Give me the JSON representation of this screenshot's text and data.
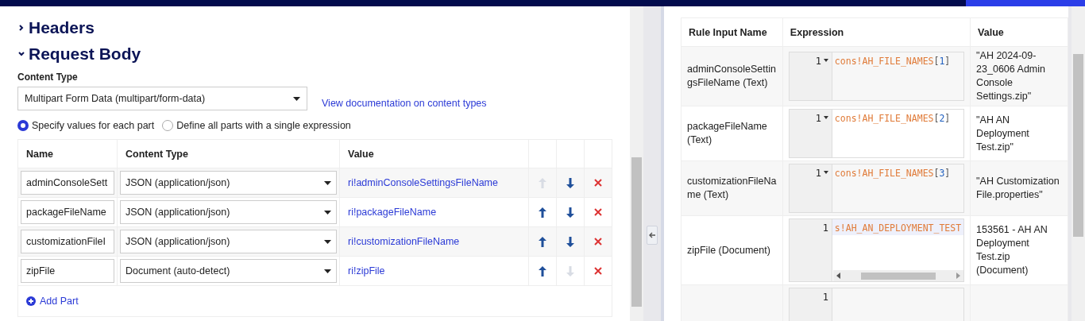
{
  "sections": [
    {
      "title": "Headers",
      "expanded": false
    },
    {
      "title": "Request Body",
      "expanded": true
    }
  ],
  "content_type": {
    "label": "Content Type",
    "value": "Multipart Form Data (multipart/form-data)",
    "link": "View documentation on content types"
  },
  "modes": [
    {
      "label": "Specify values for each part",
      "selected": true
    },
    {
      "label": "Define all parts with a single expression",
      "selected": false
    }
  ],
  "parts_table": {
    "columns": [
      "Name",
      "Content Type",
      "Value"
    ],
    "rows": [
      {
        "name": "adminConsoleSett",
        "content_type": "JSON (application/json)",
        "value": "ri!adminConsoleSettingsFileName",
        "up_disabled": true,
        "down_disabled": false
      },
      {
        "name": "packageFileName",
        "content_type": "JSON (application/json)",
        "value": "ri!packageFileName",
        "up_disabled": false,
        "down_disabled": false
      },
      {
        "name": "customizationFileI",
        "content_type": "JSON (application/json)",
        "value": "ri!customizationFileName",
        "up_disabled": false,
        "down_disabled": false
      },
      {
        "name": "zipFile",
        "content_type": "Document (auto-detect)",
        "value": "ri!zipFile",
        "up_disabled": false,
        "down_disabled": true
      }
    ],
    "add_label": "Add Part"
  },
  "rule_inputs": {
    "columns": [
      "Rule Input Name",
      "Expression",
      "Value"
    ],
    "rows": [
      {
        "name": "adminConsoleSettingsFileName (Text)",
        "line": "1",
        "fold": true,
        "hscroll": false,
        "code": [
          {
            "text": "cons!AH_FILE_NAMES",
            "kind": "constant"
          },
          {
            "text": "[",
            "kind": "bracket"
          },
          {
            "text": "1",
            "kind": "number"
          },
          {
            "text": "]",
            "kind": "bracket"
          }
        ],
        "value": "\"AH 2024-09-23_0606 Admin Console Settings.zip\""
      },
      {
        "name": "packageFileName (Text)",
        "line": "1",
        "fold": true,
        "hscroll": false,
        "code": [
          {
            "text": "cons!AH_FILE_NAMES",
            "kind": "constant"
          },
          {
            "text": "[",
            "kind": "bracket"
          },
          {
            "text": "2",
            "kind": "number"
          },
          {
            "text": "]",
            "kind": "bracket"
          }
        ],
        "value": "\"AH AN Deployment Test.zip\""
      },
      {
        "name": "customizationFileName (Text)",
        "line": "1",
        "fold": true,
        "hscroll": false,
        "code": [
          {
            "text": "cons!AH_FILE_NAMES",
            "kind": "constant"
          },
          {
            "text": "[",
            "kind": "bracket"
          },
          {
            "text": "3",
            "kind": "number"
          },
          {
            "text": "]",
            "kind": "bracket"
          }
        ],
        "value": "\"AH Customization File.properties\""
      },
      {
        "name": "zipFile (Document)",
        "line": "1",
        "fold": false,
        "hscroll": true,
        "code": [
          {
            "text": "s!AH_AN_DEPLOYMENT_TEST",
            "kind": "constant"
          }
        ],
        "value": "153561 - AH AN Deployment Test.zip (Document)"
      },
      {
        "line": "1",
        "fold": false,
        "hscroll": false,
        "code": []
      }
    ]
  }
}
